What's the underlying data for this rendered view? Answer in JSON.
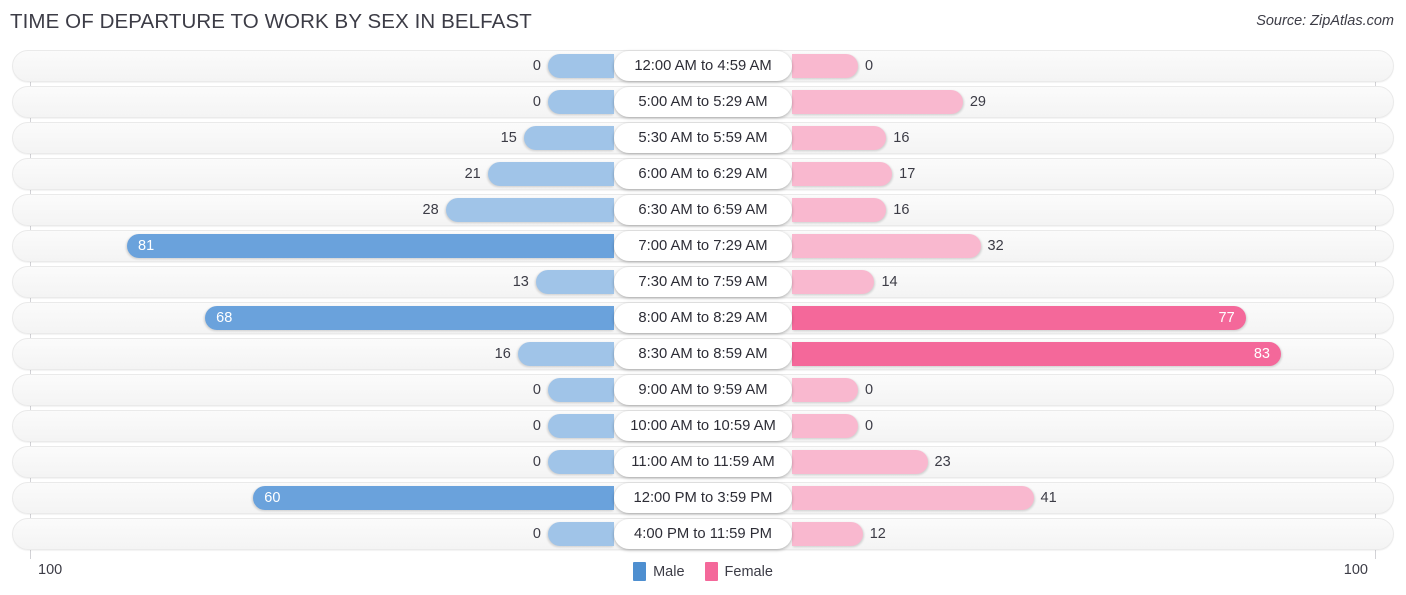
{
  "header": {
    "title": "TIME OF DEPARTURE TO WORK BY SEX IN BELFAST",
    "source": "Source: ZipAtlas.com"
  },
  "legend": {
    "male_label": "Male",
    "female_label": "Female",
    "male_color": "#4e8fd0",
    "female_color": "#f4689a"
  },
  "axis": {
    "left_label": "100",
    "right_label": "100",
    "max": 100
  },
  "colors": {
    "male_light": "#a0c4e8",
    "male_dark": "#6aa2dc",
    "female_light": "#f9b8cf",
    "female_dark": "#f4689a",
    "track": "#f5f5f5",
    "text": "#3c3c46"
  },
  "chart_data": {
    "type": "bar",
    "title": "TIME OF DEPARTURE TO WORK BY SEX IN BELFAST",
    "subtitle": "Source: ZipAtlas.com",
    "orientation": "horizontal-diverging",
    "xlabel": "",
    "ylabel": "",
    "xlim": [
      0,
      100
    ],
    "grid": false,
    "legend_position": "bottom-center",
    "categories": [
      "12:00 AM to 4:59 AM",
      "5:00 AM to 5:29 AM",
      "5:30 AM to 5:59 AM",
      "6:00 AM to 6:29 AM",
      "6:30 AM to 6:59 AM",
      "7:00 AM to 7:29 AM",
      "7:30 AM to 7:59 AM",
      "8:00 AM to 8:29 AM",
      "8:30 AM to 8:59 AM",
      "9:00 AM to 9:59 AM",
      "10:00 AM to 10:59 AM",
      "11:00 AM to 11:59 AM",
      "12:00 PM to 3:59 PM",
      "4:00 PM to 11:59 PM"
    ],
    "series": [
      {
        "name": "Male",
        "values": [
          0,
          0,
          15,
          21,
          28,
          81,
          13,
          68,
          16,
          0,
          0,
          0,
          60,
          0
        ]
      },
      {
        "name": "Female",
        "values": [
          0,
          29,
          16,
          17,
          16,
          32,
          14,
          77,
          83,
          0,
          0,
          23,
          41,
          12
        ]
      }
    ]
  },
  "rows": [
    {
      "category": "12:00 AM to 4:59 AM",
      "male": "0",
      "female": "0",
      "male_val": 0,
      "female_val": 0
    },
    {
      "category": "5:00 AM to 5:29 AM",
      "male": "0",
      "female": "29",
      "male_val": 0,
      "female_val": 29
    },
    {
      "category": "5:30 AM to 5:59 AM",
      "male": "15",
      "female": "16",
      "male_val": 15,
      "female_val": 16
    },
    {
      "category": "6:00 AM to 6:29 AM",
      "male": "21",
      "female": "17",
      "male_val": 21,
      "female_val": 17
    },
    {
      "category": "6:30 AM to 6:59 AM",
      "male": "28",
      "female": "16",
      "male_val": 28,
      "female_val": 16
    },
    {
      "category": "7:00 AM to 7:29 AM",
      "male": "81",
      "female": "32",
      "male_val": 81,
      "female_val": 32
    },
    {
      "category": "7:30 AM to 7:59 AM",
      "male": "13",
      "female": "14",
      "male_val": 13,
      "female_val": 14
    },
    {
      "category": "8:00 AM to 8:29 AM",
      "male": "68",
      "female": "77",
      "male_val": 68,
      "female_val": 77
    },
    {
      "category": "8:30 AM to 8:59 AM",
      "male": "16",
      "female": "83",
      "male_val": 16,
      "female_val": 83
    },
    {
      "category": "9:00 AM to 9:59 AM",
      "male": "0",
      "female": "0",
      "male_val": 0,
      "female_val": 0
    },
    {
      "category": "10:00 AM to 10:59 AM",
      "male": "0",
      "female": "0",
      "male_val": 0,
      "female_val": 0
    },
    {
      "category": "11:00 AM to 11:59 AM",
      "male": "0",
      "female": "23",
      "male_val": 0,
      "female_val": 23
    },
    {
      "category": "12:00 PM to 3:59 PM",
      "male": "60",
      "female": "41",
      "male_val": 60,
      "female_val": 41
    },
    {
      "category": "4:00 PM to 11:59 PM",
      "male": "0",
      "female": "12",
      "male_val": 0,
      "female_val": 12
    }
  ]
}
